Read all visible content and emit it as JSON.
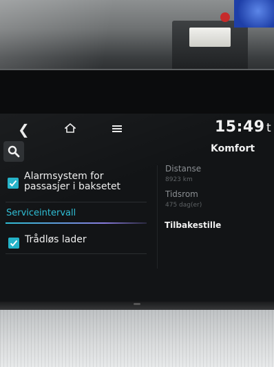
{
  "topbar": {
    "back_icon": "back-arrow-icon",
    "home_icon": "home-icon",
    "menu_icon": "menu-icon",
    "clock": "15:49",
    "clock_suffix": "t"
  },
  "search": {
    "icon": "search-icon"
  },
  "header": {
    "title": "Komfort"
  },
  "settings_list": {
    "items": [
      {
        "label": "Alarmsystem for passasjer i baksetet",
        "checked": true
      },
      {
        "label": "Trådløs lader",
        "checked": true
      }
    ],
    "section": {
      "label": "Serviceintervall"
    }
  },
  "service_details": {
    "distance_label": "Distanse",
    "distance_value": "8923 km",
    "period_label": "Tidsrom",
    "period_value": "475 dag(er)",
    "reset_label": "Tilbakestille"
  },
  "colors": {
    "accent": "#2fbfd6",
    "checkbox": "#24b3c8",
    "screen_bg": "#121416"
  }
}
